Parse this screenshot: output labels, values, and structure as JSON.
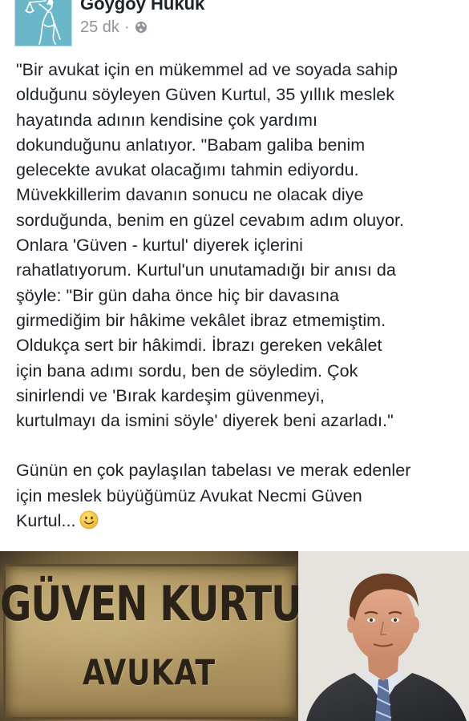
{
  "post": {
    "page_name": "Göygöy Hukuk",
    "timestamp": "25 dk",
    "separator": "·",
    "privacy_icon": "globe-icon",
    "more_icon": "chevron-down-icon",
    "text_lines": [
      "\"Bir avukat için en mükemmel ad ve soyada sahip",
      "olduğunu söyleyen Güven Kurtul, 35 yıllık meslek",
      "hayatında adının kendisine çok yardımı",
      "dokunduğunu anlatıyor. \"Babam galiba benim",
      "gelecekte avukat olacağımı tahmin ediyordu.",
      "Müvekkillerim davanın sonucu ne olacak diye",
      "sorduğunda, benim en güzel cevabım adım oluyor.",
      "Onlara 'Güven - kurtul' diyerek içlerini",
      "rahatlatıyorum. Kurtul'un unutamadığı bir anısı da",
      "şöyle: \"Bir gün daha önce hiç bir davasına",
      "girmediğim bir hâkime vekâlet ibraz etmemiştim.",
      "Oldukça sert bir hâkimdi. İbrazı gereken vekâlet",
      "için bana adımı sordu, ben de söyledim. Çok",
      "sinirlendi ve 'Bırak kardeşim güvenmeyi,",
      "kurtulmayı da ismini söyle' diyerek beni azarladı.\""
    ],
    "text_lines_2": [
      "Günün en çok paylaşılan tabelası ve merak edenler",
      "için meslek büyüğümüz Avukat Necmi Güven",
      "Kurtul..."
    ],
    "emoji": "smile-icon"
  },
  "media": {
    "sign_title": "GÜVEN KURTUL",
    "sign_subtitle": "AVUKAT"
  },
  "colors": {
    "text": "#1d2129",
    "meta": "#90949c",
    "avatar_bg": "#5aa8bd",
    "emoji": "#f6c93a"
  }
}
